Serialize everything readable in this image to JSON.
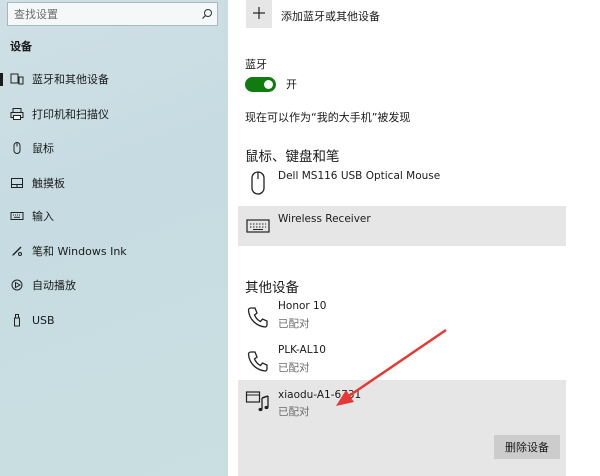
{
  "sidebar": {
    "search_placeholder": "查找设置",
    "title": "设备",
    "items": [
      {
        "label": "蓝牙和其他设备",
        "icon": "bluetooth-devices-icon"
      },
      {
        "label": "打印机和扫描仪",
        "icon": "printer-icon"
      },
      {
        "label": "鼠标",
        "icon": "mouse-icon"
      },
      {
        "label": "触摸板",
        "icon": "touchpad-icon"
      },
      {
        "label": "输入",
        "icon": "keyboard-icon"
      },
      {
        "label": "笔和 Windows Ink",
        "icon": "pen-icon"
      },
      {
        "label": "自动播放",
        "icon": "autoplay-icon"
      },
      {
        "label": "USB",
        "icon": "usb-icon"
      }
    ],
    "selected_index": 0
  },
  "main": {
    "add_device_label": "添加蓝牙或其他设备",
    "bluetooth_label": "蓝牙",
    "bluetooth_state": "开",
    "discoverable_text": "现在可以作为“我的大手机”被发现",
    "mouse_section_title": "鼠标、键盘和笔",
    "mouse_devices": [
      {
        "name": "Dell MS116 USB Optical Mouse",
        "icon": "mouse-icon"
      },
      {
        "name": "Wireless Receiver",
        "icon": "keyboard-icon"
      }
    ],
    "other_section_title": "其他设备",
    "other_devices": [
      {
        "name": "Honor 10",
        "status": "已配对",
        "icon": "phone-icon"
      },
      {
        "name": "PLK-AL10",
        "status": "已配对",
        "icon": "phone-icon"
      },
      {
        "name": "xiaodu-A1-6731",
        "status": "已配对",
        "icon": "media-device-icon"
      }
    ],
    "remove_button_label": "删除设备"
  },
  "colors": {
    "toggle_on": "#107c10",
    "arrow": "#e53935",
    "sidebar_bg": "#c6dce2",
    "highlight_bg": "#e6e6e6"
  }
}
